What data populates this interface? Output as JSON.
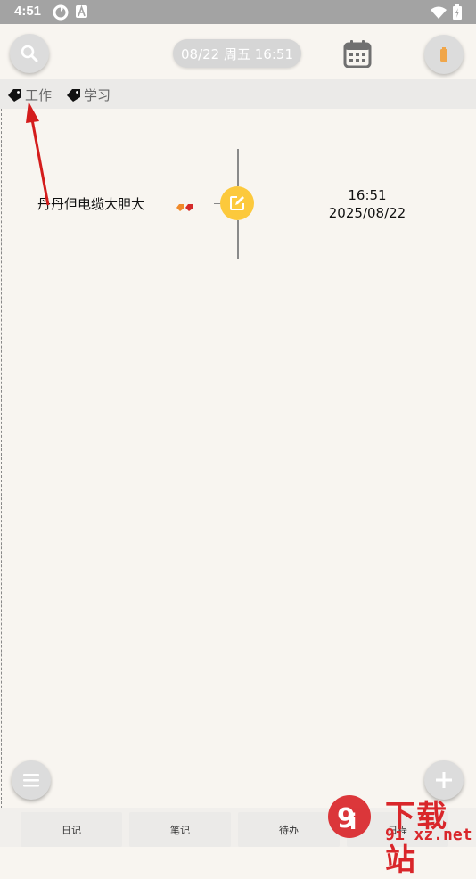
{
  "status_bar": {
    "time": "4:51"
  },
  "header": {
    "date_pill": "08/22 周五  16:51"
  },
  "tags": [
    {
      "label": "工作"
    },
    {
      "label": "学习"
    }
  ],
  "entry": {
    "title": "丹丹但电缆大胆大",
    "time": "16:51",
    "date": "2025/08/22"
  },
  "bottom_tabs": [
    "日记",
    "笔记",
    "待办",
    "日程"
  ],
  "watermark": {
    "main": "下载站",
    "sub": "9i xz.net"
  },
  "colors": {
    "accent": "#fcc93c",
    "annotation_arrow": "#d41c1c"
  }
}
